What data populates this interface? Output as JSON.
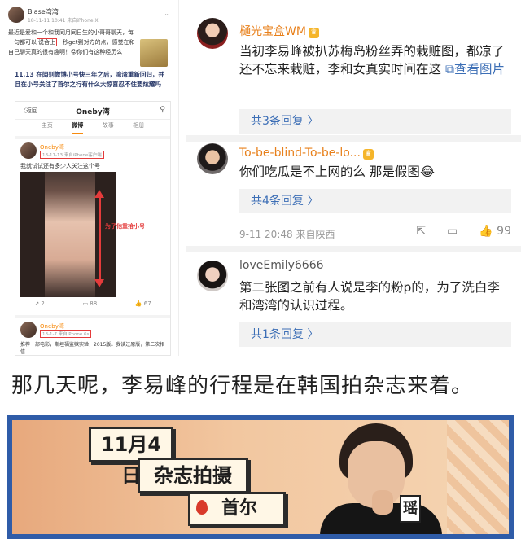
{
  "left_screenshot": {
    "top_post": {
      "name": "Blase湾湾",
      "time": "18-11-11 10:41 来自iPhone X",
      "text_before": "最近是爱和一个和我同月同日生的小哥哥聊天，每一句都可以",
      "highlight": "说合上",
      "text_after": "一秒get到对方的点，感觉在和自己聊天真的很有趣啊！😜你们有这种经历么"
    },
    "middle_text": "11.13 在阔别微博小号快三年之后，湾湾重新回归，并且在小号关注了首尔之行有什么大惊喜忍不住要炫耀吗",
    "phone": {
      "back": "〈返回",
      "title": "Oneby湾",
      "tabs": [
        "主页",
        "微博",
        "故事",
        "相册"
      ],
      "active_tab": "微博",
      "post1": {
        "name": "Oneby湾",
        "meta": "18-11-13 来自iPhone客户端",
        "text": "我就试试还有多少人关注这个号",
        "arrow_label": "为了他重拾小号",
        "actions": [
          "2",
          "88",
          "67"
        ]
      },
      "post2": {
        "name": "Oneby湾",
        "meta": "18-1-7 来自iPhone 6s",
        "text": "推荐一部电影，斯坦福监狱实验，2015版。我读过原版，第二次相信..."
      }
    }
  },
  "comments": [
    {
      "name": "樋光宝盒WM",
      "text": "当初李易峰被扒苏梅岛粉丝弄的栽赃图，都凉了还不忘来栽赃，李和女真实时间在这",
      "link": "查看图片",
      "replies": "共3条回复 〉"
    },
    {
      "name": "To-be-blind-To-be-lo...",
      "text": "你们吃瓜是不上网的么 那是假图😂",
      "replies": "共4条回复 〉",
      "meta": "9-11 20:48 来自陕西",
      "like_count": "99"
    },
    {
      "name": "loveEmily6666",
      "text": "第二张图之前有人说是李的粉p的，为了洗白李和湾湾的认识过程。",
      "replies": "共1条回复 〉"
    }
  ],
  "caption": "那几天呢，李易峰的行程是在韩国拍杂志来着。",
  "tv_still": {
    "date": "11月4日",
    "event": "杂志拍摄",
    "location": "首尔",
    "logo": "瑶"
  },
  "colors": {
    "accent_orange": "#e8801b",
    "link_blue": "#3d6fb6",
    "highlight_red": "#e43b3b"
  }
}
